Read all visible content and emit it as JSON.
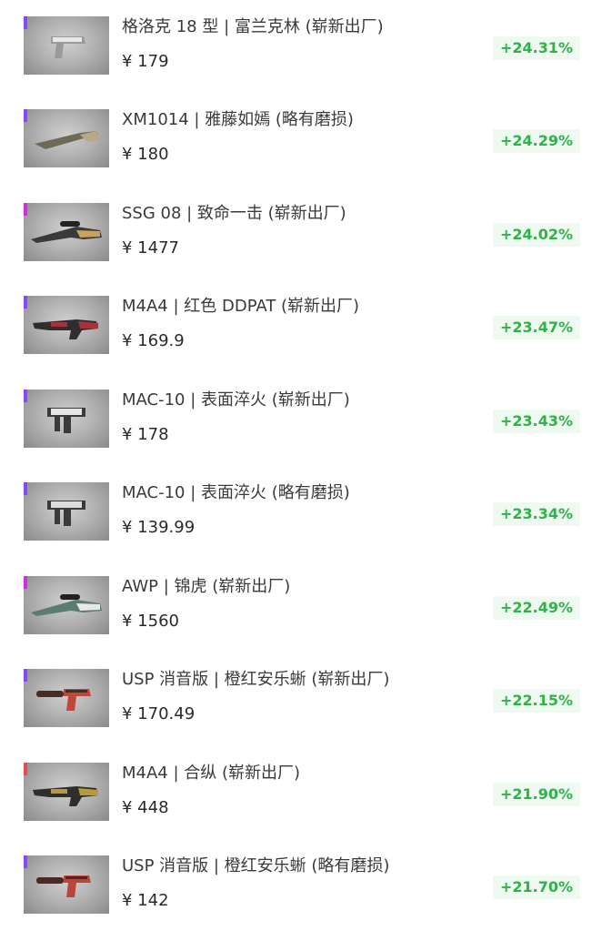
{
  "items": [
    {
      "title": "格洛克 18 型 | 富兰克林 (崭新出厂)",
      "price": "¥ 179",
      "change": "+24.31%",
      "rarity_color": "#8847ff",
      "weapon_icon": "pistol-icon",
      "body_color": "#9a9a9a",
      "accent_color": "#e8e8e8"
    },
    {
      "title": "XM1014 | 雅藤如嫣 (略有磨损)",
      "price": "¥ 180",
      "change": "+24.29%",
      "rarity_color": "#8847ff",
      "weapon_icon": "shotgun-icon",
      "body_color": "#6e6a5a",
      "accent_color": "#b9a989"
    },
    {
      "title": "SSG 08 | 致命一击 (崭新出厂)",
      "price": "¥ 1477",
      "change": "+24.02%",
      "rarity_color": "#d32ce6",
      "weapon_icon": "sniper-icon",
      "body_color": "#3a3a3a",
      "accent_color": "#c8a45a"
    },
    {
      "title": "M4A4 | 红色 DDPAT (崭新出厂)",
      "price": "¥ 169.9",
      "change": "+23.47%",
      "rarity_color": "#8847ff",
      "weapon_icon": "rifle-icon",
      "body_color": "#2e2e2e",
      "accent_color": "#a8323a"
    },
    {
      "title": "MAC-10 | 表面淬火 (崭新出厂)",
      "price": "¥ 178",
      "change": "+23.43%",
      "rarity_color": "#8847ff",
      "weapon_icon": "smg-icon",
      "body_color": "#3a3a3a",
      "accent_color": "#e6e6e6"
    },
    {
      "title": "MAC-10 | 表面淬火 (略有磨损)",
      "price": "¥ 139.99",
      "change": "+23.34%",
      "rarity_color": "#8847ff",
      "weapon_icon": "smg-icon",
      "body_color": "#3a3a3a",
      "accent_color": "#dcdcdc"
    },
    {
      "title": "AWP | 锦虎 (崭新出厂)",
      "price": "¥ 1560",
      "change": "+22.49%",
      "rarity_color": "#d32ce6",
      "weapon_icon": "sniper-icon",
      "body_color": "#5a7c72",
      "accent_color": "#e9e9e9"
    },
    {
      "title": "USP 消音版 | 橙红安乐蜥 (崭新出厂)",
      "price": "¥ 170.49",
      "change": "+22.15%",
      "rarity_color": "#8847ff",
      "weapon_icon": "pistol-silenced-icon",
      "body_color": "#4a2a24",
      "accent_color": "#c0483a"
    },
    {
      "title": "M4A4 | 合纵 (崭新出厂)",
      "price": "¥ 448",
      "change": "+21.90%",
      "rarity_color": "#eb4b4b",
      "weapon_icon": "rifle-icon",
      "body_color": "#2e2e2a",
      "accent_color": "#b79a3a"
    },
    {
      "title": "USP 消音版 | 橙红安乐蜥 (略有磨损)",
      "price": "¥ 142",
      "change": "+21.70%",
      "rarity_color": "#8847ff",
      "weapon_icon": "pistol-silenced-icon",
      "body_color": "#4a2a24",
      "accent_color": "#b8463a"
    }
  ]
}
